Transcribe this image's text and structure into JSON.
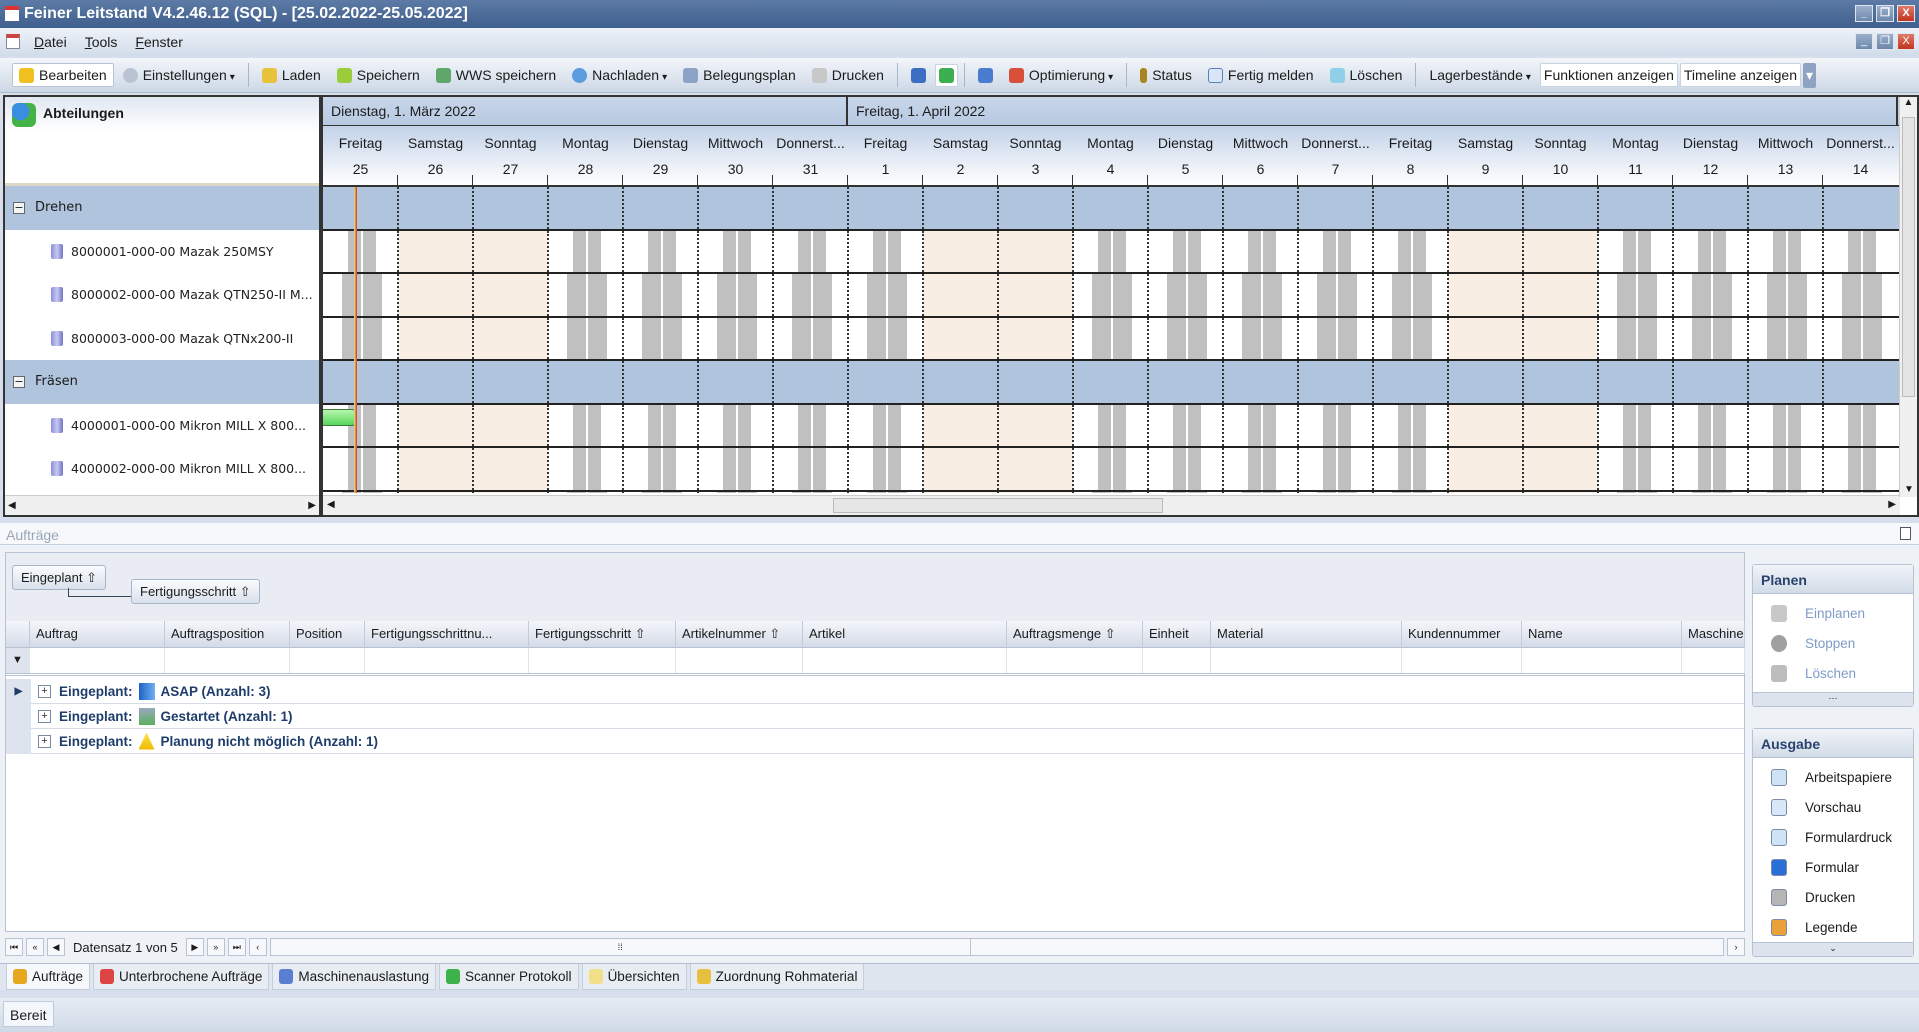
{
  "window": {
    "title": "Feiner Leitstand V4.2.46.12 (SQL) - [25.02.2022-25.05.2022]"
  },
  "menu": [
    "Datei",
    "Tools",
    "Fenster"
  ],
  "toolbar": {
    "bearbeiten": "Bearbeiten",
    "einstellungen": "Einstellungen",
    "laden": "Laden",
    "speichern": "Speichern",
    "wws_speichern": "WWS speichern",
    "nachladen": "Nachladen",
    "belegungsplan": "Belegungsplan",
    "drucken": "Drucken",
    "optimierung": "Optimierung",
    "status": "Status",
    "fertig_melden": "Fertig melden",
    "loeschen": "Löschen",
    "lagerbestaende": "Lagerbestände",
    "funktionen_anzeigen": "Funktionen anzeigen",
    "timeline_anzeigen": "Timeline anzeigen"
  },
  "tree": {
    "title": "Abteilungen",
    "rows": [
      {
        "type": "group",
        "label": "Drehen"
      },
      {
        "type": "machine",
        "label": "8000001-000-00 Mazak 250MSY",
        "shifts": [
          [
            8,
            12.2
          ],
          [
            12.7,
            17
          ]
        ]
      },
      {
        "type": "machine",
        "label": "8000002-000-00 Mazak QTN250-II M...",
        "shifts": [
          [
            6,
            12.2
          ],
          [
            12.7,
            19
          ]
        ]
      },
      {
        "type": "machine",
        "label": "8000003-000-00 Mazak QTNx200-II",
        "shifts": [
          [
            6,
            12.2
          ],
          [
            12.7,
            19
          ]
        ]
      },
      {
        "type": "group",
        "label": "Fräsen"
      },
      {
        "type": "machine",
        "label": "4000001-000-00 Mikron MILL X 800...",
        "shifts": [
          [
            8,
            12.2
          ],
          [
            12.7,
            17
          ]
        ]
      },
      {
        "type": "machine",
        "label": "4000002-000-00 Mikron MILL X 800...",
        "shifts": [
          [
            8,
            12.2
          ],
          [
            12.7,
            17
          ]
        ]
      }
    ]
  },
  "gantt": {
    "months": [
      {
        "label": "Dienstag, 1. März 2022",
        "days": 7
      },
      {
        "label": "Freitag, 1. April 2022",
        "days": 14
      }
    ],
    "days": [
      {
        "name": "Freitag",
        "num": "25",
        "weekend": false
      },
      {
        "name": "Samstag",
        "num": "26",
        "weekend": true
      },
      {
        "name": "Sonntag",
        "num": "27",
        "weekend": true
      },
      {
        "name": "Montag",
        "num": "28",
        "weekend": false
      },
      {
        "name": "Dienstag",
        "num": "29",
        "weekend": false
      },
      {
        "name": "Mittwoch",
        "num": "30",
        "weekend": false
      },
      {
        "name": "Donnerst...",
        "num": "31",
        "weekend": false
      },
      {
        "name": "Freitag",
        "num": "1",
        "weekend": false
      },
      {
        "name": "Samstag",
        "num": "2",
        "weekend": true
      },
      {
        "name": "Sonntag",
        "num": "3",
        "weekend": true
      },
      {
        "name": "Montag",
        "num": "4",
        "weekend": false
      },
      {
        "name": "Dienstag",
        "num": "5",
        "weekend": false
      },
      {
        "name": "Mittwoch",
        "num": "6",
        "weekend": false
      },
      {
        "name": "Donnerst...",
        "num": "7",
        "weekend": false
      },
      {
        "name": "Freitag",
        "num": "8",
        "weekend": false
      },
      {
        "name": "Samstag",
        "num": "9",
        "weekend": true
      },
      {
        "name": "Sonntag",
        "num": "10",
        "weekend": true
      },
      {
        "name": "Montag",
        "num": "11",
        "weekend": false
      },
      {
        "name": "Dienstag",
        "num": "12",
        "weekend": false
      },
      {
        "name": "Mittwoch",
        "num": "13",
        "weekend": false
      },
      {
        "name": "Donnerst...",
        "num": "14",
        "weekend": false
      }
    ],
    "now_hour_day0": 10.6,
    "task": {
      "row": 5,
      "end_hour_day0": 10.6
    }
  },
  "orders": {
    "panel_title": "Aufträge",
    "group_chips": [
      "Eingeplant",
      "Fertigungsschritt"
    ],
    "columns": [
      "Auftrag",
      "Auftragsposition",
      "Position",
      "Fertigungsschrittnu...",
      "Fertigungsschritt",
      "Artikelnummer",
      "Artikel",
      "Auftragsmenge",
      "Einheit",
      "Material",
      "Kundennummer",
      "Name",
      "Maschine"
    ],
    "groups": [
      {
        "prefix": "Eingeplant:",
        "label": "ASAP (Anzahl: 3)",
        "icon": "asap-icon"
      },
      {
        "prefix": "Eingeplant:",
        "label": "Gestartet (Anzahl: 1)",
        "icon": "gears-icon"
      },
      {
        "prefix": "Eingeplant:",
        "label": "Planung nicht möglich (Anzahl: 1)",
        "icon": "warning-icon"
      }
    ],
    "navigator": "Datensatz 1 von 5"
  },
  "side": {
    "planen": {
      "title": "Planen",
      "items": [
        "Einplanen",
        "Stoppen",
        "Löschen"
      ]
    },
    "ausgabe": {
      "title": "Ausgabe",
      "items": [
        "Arbeitspapiere",
        "Vorschau",
        "Formulardruck",
        "Formular",
        "Drucken",
        "Legende"
      ]
    }
  },
  "tabs": [
    "Aufträge",
    "Unterbrochene Aufträge",
    "Maschinenauslastung",
    "Scanner Protokoll",
    "Übersichten",
    "Zuordnung Rohmaterial"
  ],
  "status": "Bereit"
}
